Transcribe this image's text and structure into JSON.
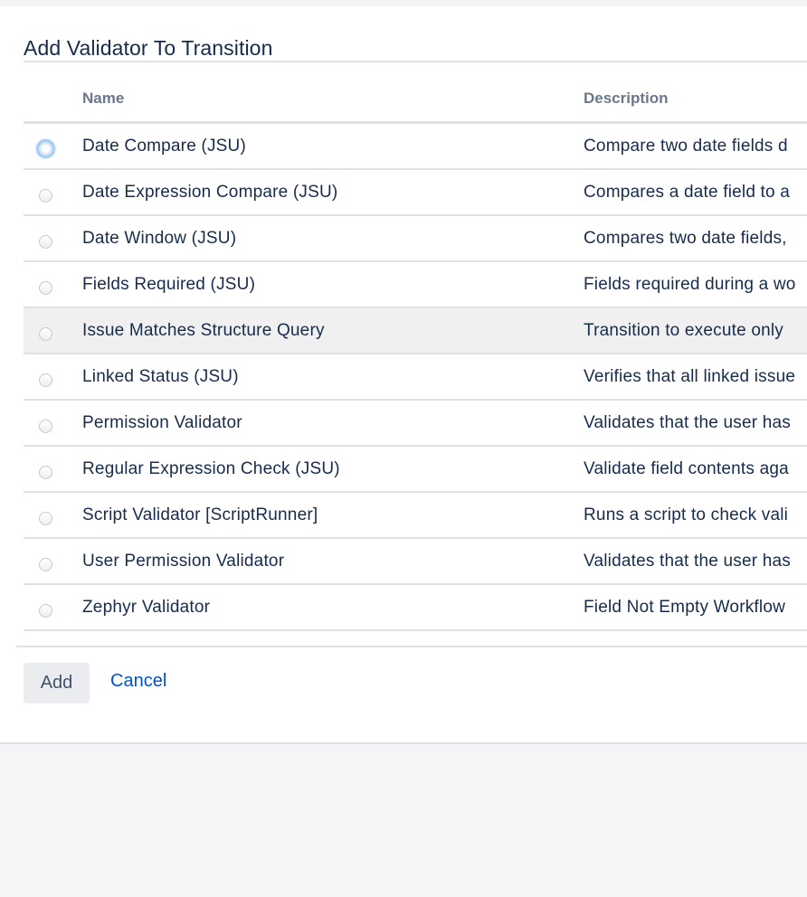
{
  "dialog": {
    "title": "Add Validator To Transition"
  },
  "table": {
    "columns": {
      "name": "Name",
      "description": "Description"
    },
    "rows": [
      {
        "name": "Date Compare (JSU)",
        "description": "Compare two date fields d",
        "selected": true
      },
      {
        "name": "Date Expression Compare (JSU)",
        "description": "Compares a date field to a"
      },
      {
        "name": "Date Window (JSU)",
        "description": "Compares two date fields,"
      },
      {
        "name": "Fields Required (JSU)",
        "description": "Fields required during a wo"
      },
      {
        "name": "Issue Matches Structure Query",
        "description": "Transition to execute only",
        "highlighted": true
      },
      {
        "name": "Linked Status (JSU)",
        "description": "Verifies that all linked issue"
      },
      {
        "name": "Permission Validator",
        "description": "Validates that the user has"
      },
      {
        "name": "Regular Expression Check (JSU)",
        "description": "Validate field contents aga"
      },
      {
        "name": "Script Validator [ScriptRunner]",
        "description": "Runs a script to check vali"
      },
      {
        "name": "User Permission Validator",
        "description": "Validates that the user has"
      },
      {
        "name": "Zephyr Validator",
        "description": "Field Not Empty Workflow"
      }
    ]
  },
  "actions": {
    "add_label": "Add",
    "cancel_label": "Cancel"
  },
  "colors": {
    "link": "#0052cc",
    "text": "#172b4d",
    "header_text": "#6b778c",
    "row_highlight": "#f0f0f0",
    "focus_ring": "#a9ccf4"
  }
}
